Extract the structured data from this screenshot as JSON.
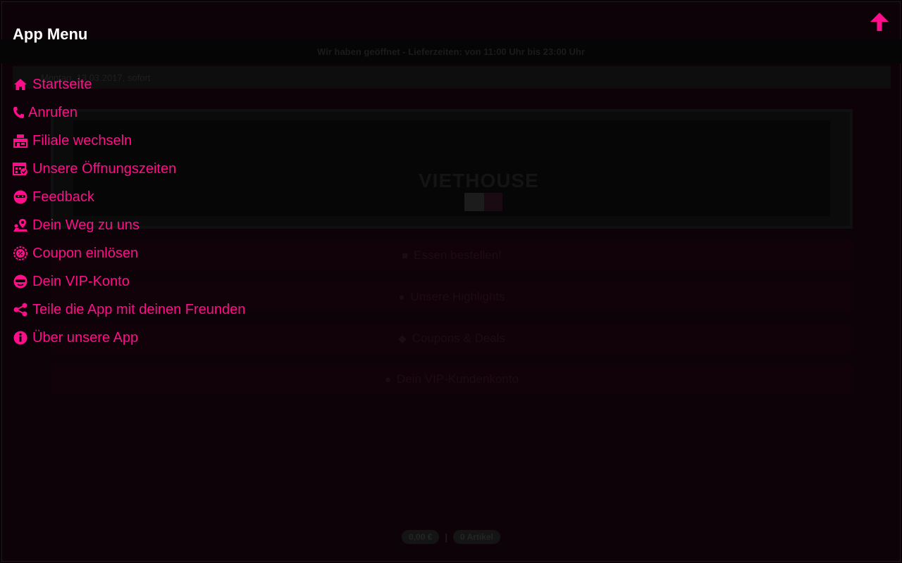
{
  "menu": {
    "title": "App Menu",
    "accent_color": "#ff0d8a",
    "items": [
      {
        "label": "Startseite",
        "icon": "home-icon"
      },
      {
        "label": "Anrufen",
        "icon": "phone-icon"
      },
      {
        "label": "Filiale wechseln",
        "icon": "store-icon"
      },
      {
        "label": "Unsere Öffnungszeiten",
        "icon": "calendar-icon"
      },
      {
        "label": "Feedback",
        "icon": "feedback-icon"
      },
      {
        "label": "Dein Weg zu uns",
        "icon": "map-pin-icon"
      },
      {
        "label": "Coupon einlösen",
        "icon": "coupon-icon"
      },
      {
        "label": "Dein VIP-Konto",
        "icon": "vip-icon"
      },
      {
        "label": "Teile die App mit deinen Freunden",
        "icon": "share-icon"
      },
      {
        "label": "Über unsere App",
        "icon": "info-icon"
      }
    ]
  },
  "background": {
    "hours_notice": "Wir haben geöffnet - Lieferzeiten: von 11:00 Uhr bis 23:00 Uhr",
    "date_info": "Montag, 13.03.2017, sofort",
    "banner_text": "VIETHOUSE",
    "buttons": [
      {
        "label": "Essen bestellen!",
        "icon": "bag-icon"
      },
      {
        "label": "Unsere Highlights",
        "icon": "star-icon"
      },
      {
        "label": "Coupons & Deals",
        "icon": "tag-icon"
      },
      {
        "label": "Dein VIP-Kundenkonto",
        "icon": "vip-icon"
      }
    ],
    "cart_total": "0,00 €",
    "cart_items": "0 Artikel"
  }
}
